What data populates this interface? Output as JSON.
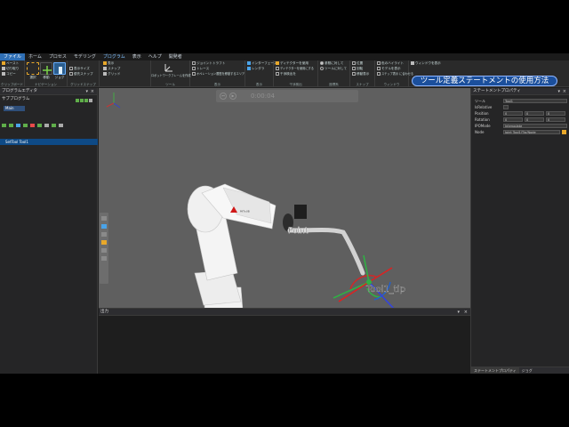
{
  "menu": [
    "ファイル",
    "ホーム",
    "プロセス",
    "モデリング",
    "プログラム",
    "表示",
    "ヘルプ",
    "開発者"
  ],
  "menu_active": "ファイル",
  "ribbon": {
    "clipboard": {
      "paste": "ペースト",
      "cut": "切り取り",
      "copy": "コピー",
      "label": "クリップボード"
    },
    "navigation": {
      "select": "選択",
      "move": "移動",
      "jog": "ジョグ",
      "label": "ナビゲーション"
    },
    "grid": {
      "snap": "スナップ",
      "grid": "グリッド",
      "show": "表示",
      "label": "グリッドスナップ"
    },
    "snap_opts": {
      "a": "表示サイズ",
      "b": "優先スナップ"
    },
    "tools": {
      "label": "ツール",
      "frame": "ロボットワークフレームを作成"
    },
    "display": {
      "label": "表示",
      "a": "ジョイントトラフト",
      "b": "トレース",
      "c": "オペレーション履歴を移動するエリア"
    },
    "interface": {
      "label": "干渉検出",
      "a": "インターフェース",
      "b": "レンダラ"
    },
    "detect": {
      "a": "ディテクターを使用",
      "b": "ディテクターを使用にする",
      "c": "干渉検出を"
    },
    "coords": {
      "label": "座標系",
      "a": "参照に対して",
      "b": "ツールに対して"
    },
    "window": {
      "a": "位置",
      "b": "回転",
      "c": "移動表示",
      "label": "スナップ"
    },
    "color": {
      "a": "色のハイライト",
      "b": "モデルを表示",
      "c": "ステップ表示 に合わせる",
      "label": "ウィンドウ"
    },
    "win2": {
      "a": "ウィンドウを表示"
    }
  },
  "banner": "ツール定義ステートメントの使用方法",
  "left_panel": {
    "title": "プログラムエディタ",
    "sub": "サブプログラム",
    "main": "Main",
    "line": "SetTool Tool1"
  },
  "viewport": {
    "timecode": "0:00:04",
    "point_label": "Point",
    "tool_label": "Tool1_tip"
  },
  "output": {
    "title": "出力"
  },
  "right_panel": {
    "title": "ステートメントプロパティ",
    "rows": [
      {
        "label": "ツール",
        "value": "Tool1"
      },
      {
        "label": "IsRelative",
        "value": ""
      },
      {
        "label": "Position",
        "value": "0"
      },
      {
        "label": "Rotation",
        "value": "0"
      },
      {
        "label": "IPOMode",
        "value": "Interpolate"
      },
      {
        "label": "Node",
        "value": "Joint Tool1/Tip/Node"
      }
    ],
    "tabs": [
      "ステートメントプロパティ",
      "ジョグ"
    ]
  }
}
